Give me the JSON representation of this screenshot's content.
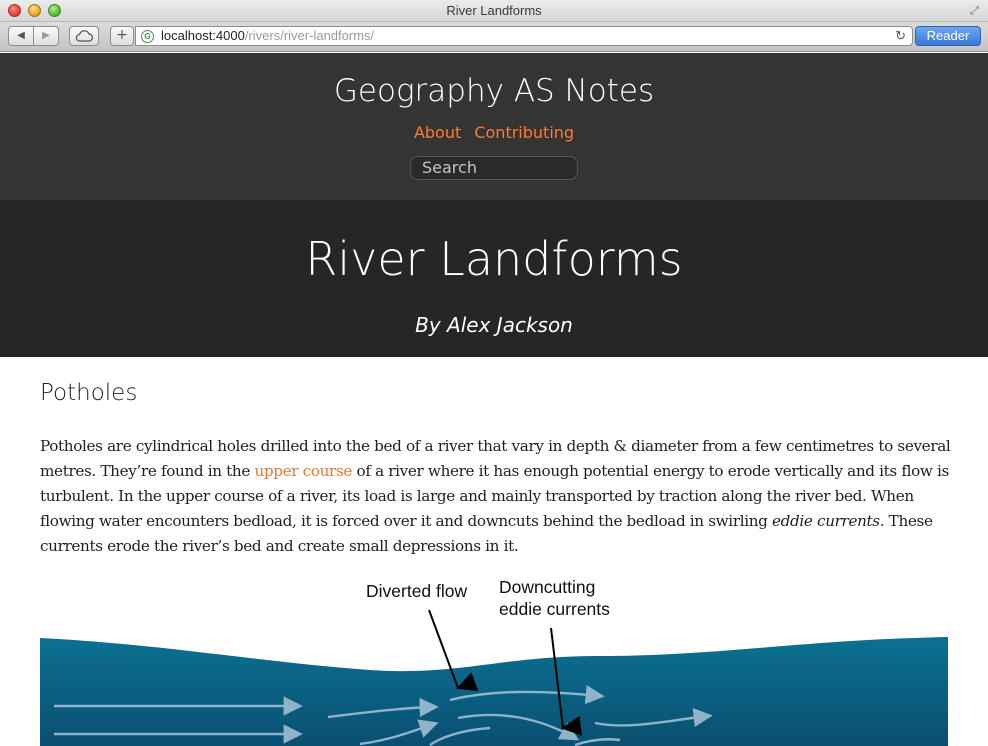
{
  "window": {
    "title": "River Landforms"
  },
  "toolbar": {
    "back_icon": "back-arrow-icon",
    "forward_icon": "forward-arrow-icon",
    "url_host": "localhost:4000",
    "url_path": "/rivers/river-landforms/",
    "reader_label": "Reader"
  },
  "site": {
    "title": "Geography AS Notes",
    "nav": [
      "About",
      "Contributing"
    ],
    "search_placeholder": "Search",
    "accent_color": "#ff7a2e"
  },
  "post": {
    "title": "River Landforms",
    "author": "By Alex Jackson"
  },
  "section": {
    "heading": "Potholes",
    "paragraph": {
      "part1": "Potholes are cylindrical holes drilled into the bed of a river that vary in depth & diameter from a few centimetres to several metres. They’re found in the ",
      "link": "upper course",
      "part2": " of a river where it has enough potential energy to erode vertically and its flow is turbulent. In the upper course of a river, its load is large and mainly transported by traction along the river bed. When flowing water encounters bedload, it is forced over it and downcuts behind the bedload in swirling ",
      "emphasis": "eddie currents",
      "part3": ". These currents erode the river’s bed and create small depressions in it."
    }
  },
  "diagram": {
    "label_diverted": "Diverted flow",
    "label_downcutting_1": "Downcutting",
    "label_downcutting_2": "eddie currents",
    "water_color": "#0a6a8c"
  }
}
